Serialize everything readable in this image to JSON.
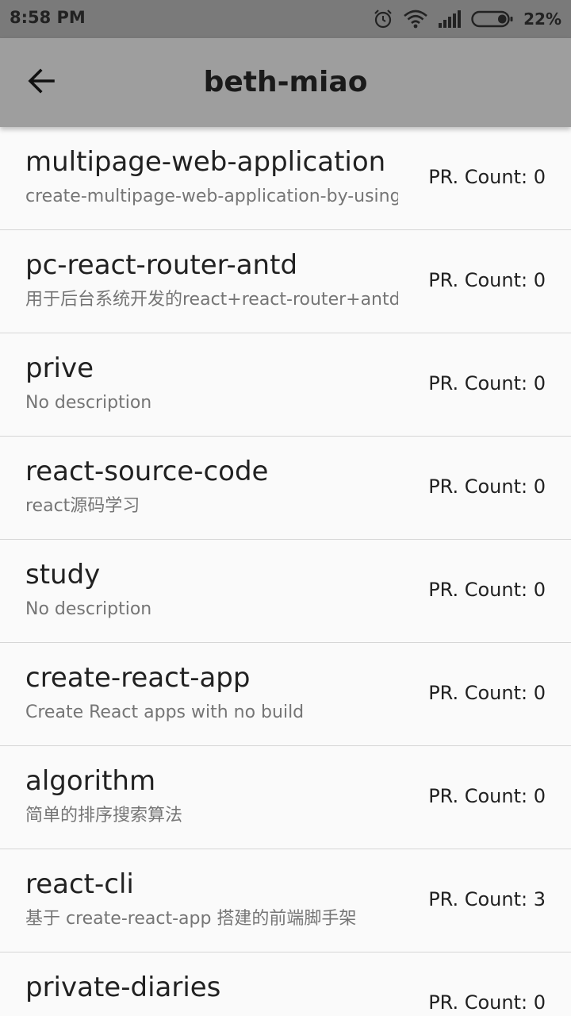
{
  "status_bar": {
    "time": "8:58 PM",
    "battery": "22%",
    "icons": [
      "alarm-icon",
      "wifi-icon",
      "signal-icon",
      "battery-icon"
    ]
  },
  "app_bar": {
    "title": "beth-miao",
    "back_icon": "arrow-left-icon"
  },
  "colors": {
    "status_bar_bg": "#7a7a7a",
    "app_bar_bg": "#9e9e9e",
    "list_bg": "#fafafa",
    "divider": "#d6d6d6",
    "primary_text": "#212121",
    "secondary_text": "#757575"
  },
  "repos": [
    {
      "name": "multipage-web-application",
      "description": "create-multipage-web-application-by-using-",
      "pr_count": "PR. Count: 0"
    },
    {
      "name": "pc-react-router-antd",
      "description": "用于后台系统开发的react+react-router+antd",
      "pr_count": "PR. Count: 0"
    },
    {
      "name": "prive",
      "description": "No description",
      "pr_count": "PR. Count: 0"
    },
    {
      "name": "react-source-code",
      "description": "react源码学习",
      "pr_count": "PR. Count: 0"
    },
    {
      "name": "study",
      "description": "No description",
      "pr_count": "PR. Count: 0"
    },
    {
      "name": "create-react-app",
      "description": "Create React apps with no build",
      "pr_count": "PR. Count: 0"
    },
    {
      "name": "algorithm",
      "description": "简单的排序搜索算法",
      "pr_count": "PR. Count: 0"
    },
    {
      "name": "react-cli",
      "description": "基于 create-react-app 搭建的前端脚手架",
      "pr_count": "PR. Count: 3"
    },
    {
      "name": "private-diaries",
      "description": "",
      "pr_count": "PR. Count: 0"
    }
  ]
}
